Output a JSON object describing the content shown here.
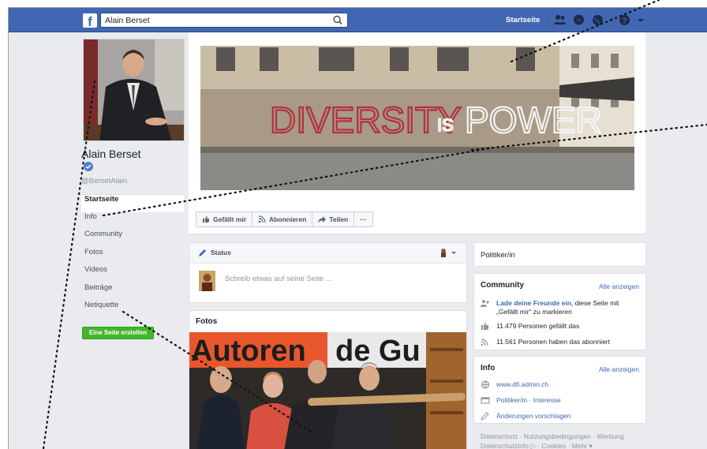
{
  "topbar": {
    "logo": "f",
    "search_value": "Alain Berset",
    "home_label": "Startseite"
  },
  "profile": {
    "name": "Alain Berset",
    "handle": "@BersetAlain"
  },
  "left_nav": {
    "items": [
      {
        "label": "Startseite"
      },
      {
        "label": "Info"
      },
      {
        "label": "Community"
      },
      {
        "label": "Fotos"
      },
      {
        "label": "Videos"
      },
      {
        "label": "Beiträge"
      },
      {
        "label": "Netiquette"
      }
    ],
    "create_page": "Eine Seite erstellen"
  },
  "cover": {
    "wall_text_1": "DIVERSITY",
    "wall_text_2": "IS",
    "wall_text_3": "POWER"
  },
  "actions": {
    "like": "Gefällt mir",
    "follow": "Abonnieren",
    "share": "Teilen",
    "more": "···"
  },
  "status": {
    "label": "Status",
    "placeholder": "Schreib etwas auf seine Seite ..."
  },
  "fotos": {
    "title": "Fotos",
    "banner_text_1": "Autoren",
    "banner_text_2": "de Gu"
  },
  "right": {
    "category": "Politiker/in",
    "community": {
      "title": "Community",
      "see_all": "Alle anzeigen",
      "invite_link": "Lade deine Freunde ein",
      "invite_rest": ", diese Seite mit „Gefällt mir“ zu markieren",
      "likes": "11.479 Personen gefällt das",
      "follows": "11.561 Personen haben das abonniert"
    },
    "info": {
      "title": "Info",
      "see_all": "Alle anzeigen",
      "website": "www.dfi.admin.ch",
      "category_link": "Politiker/in",
      "separator": " · ",
      "interests_link": "Interesse",
      "suggest": "Änderungen vorschlagen"
    }
  },
  "footer": {
    "line1": "Datenschutz · Nutzungsbedingungen · Werbung ·",
    "line2": "Datenschutzinfo ▷ · Cookies · Mehr ▾"
  },
  "colors": {
    "brand": "#4267b2",
    "page_bg": "#e9ebee",
    "create_button": "#42b72a"
  }
}
